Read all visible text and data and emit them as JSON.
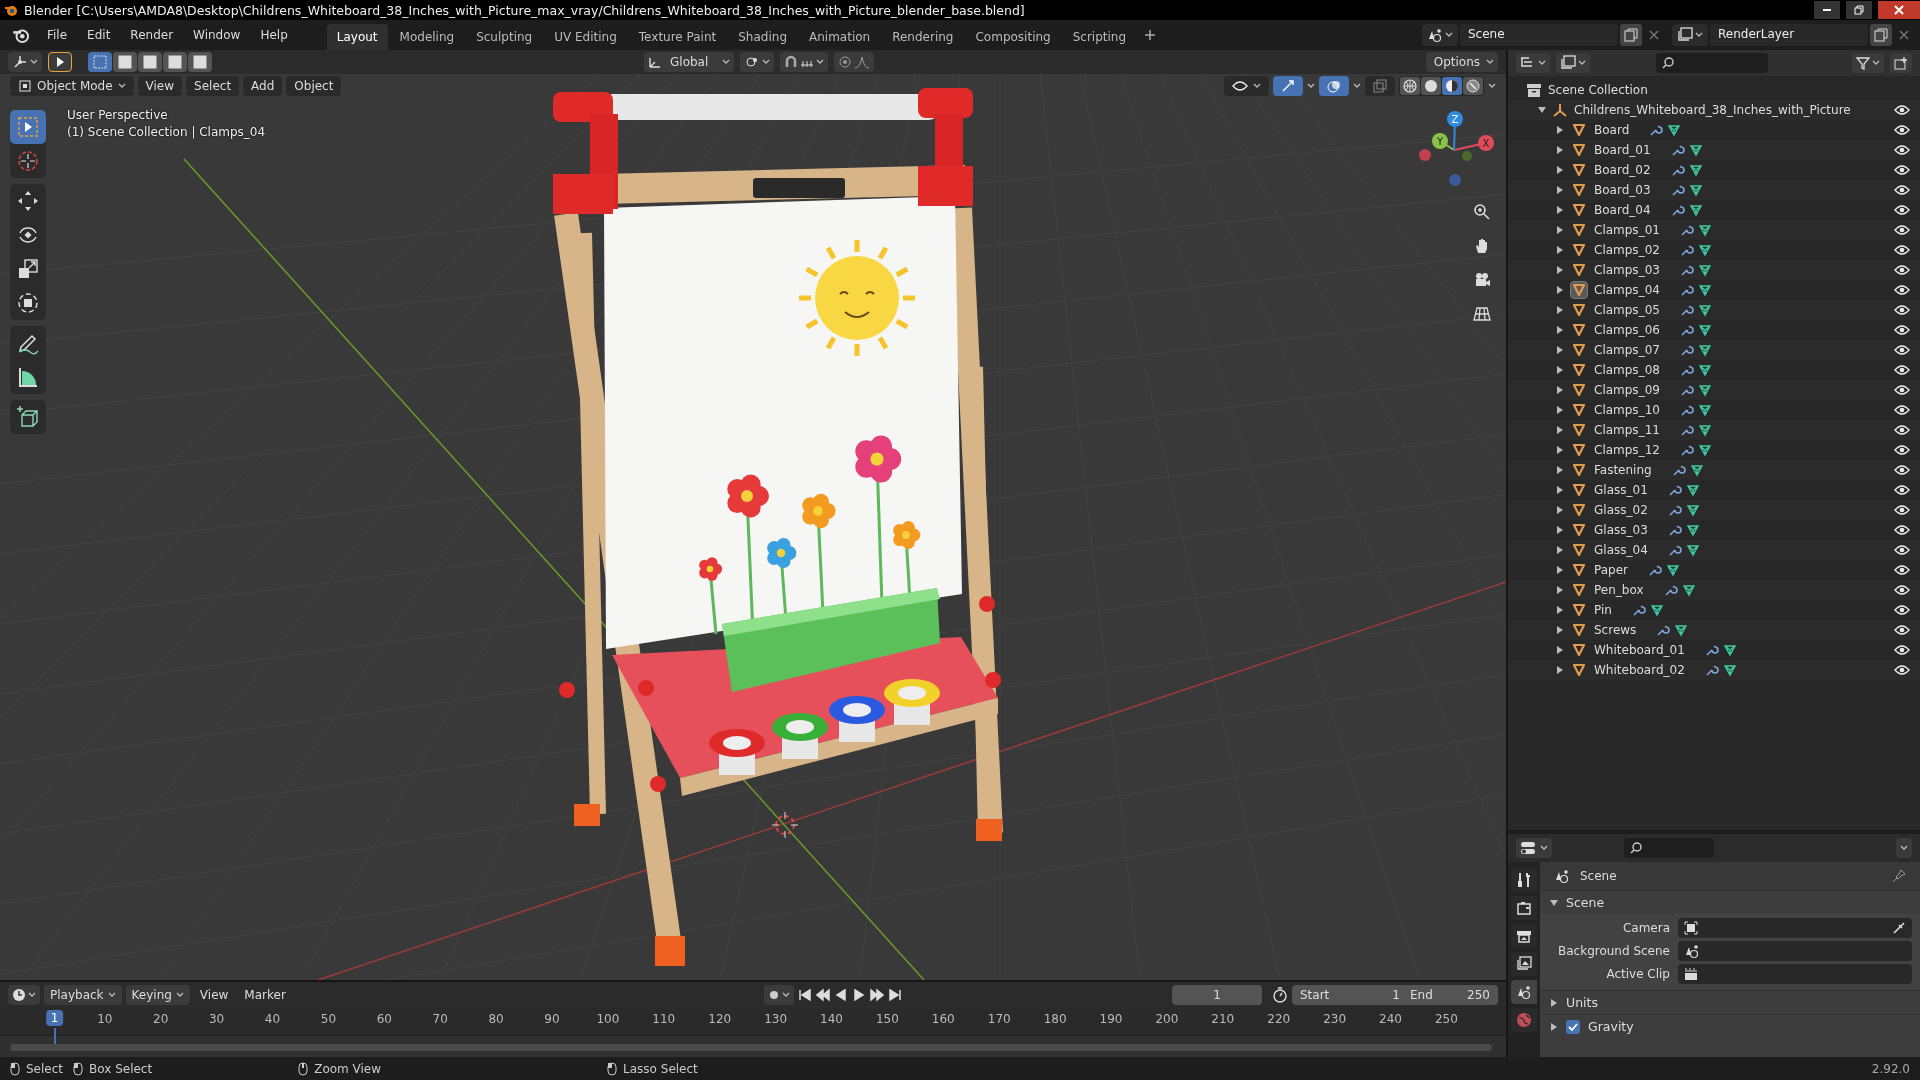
{
  "window": {
    "title": "Blender [C:\\Users\\AMDA8\\Desktop\\Childrens_Whiteboard_38_Inches_with_Picture_max_vray/Childrens_Whiteboard_38_Inches_with_Picture_blender_base.blend]"
  },
  "menu": [
    "File",
    "Edit",
    "Render",
    "Window",
    "Help"
  ],
  "workspaces": [
    {
      "label": "Layout",
      "selected": true
    },
    {
      "label": "Modeling",
      "selected": false
    },
    {
      "label": "Sculpting",
      "selected": false
    },
    {
      "label": "UV Editing",
      "selected": false
    },
    {
      "label": "Texture Paint",
      "selected": false
    },
    {
      "label": "Shading",
      "selected": false
    },
    {
      "label": "Animation",
      "selected": false
    },
    {
      "label": "Rendering",
      "selected": false
    },
    {
      "label": "Compositing",
      "selected": false
    },
    {
      "label": "Scripting",
      "selected": false
    }
  ],
  "top_fields": {
    "scene": "Scene",
    "view_layer": "RenderLayer"
  },
  "tool_settings": {
    "transform_orientation": "Global",
    "snap": false,
    "proportional_editing": false,
    "options": "Options"
  },
  "viewport_header": {
    "mode": "Object Mode",
    "menus": [
      "View",
      "Select",
      "Add",
      "Object"
    ],
    "gizmos": true,
    "overlays": true,
    "xray": false
  },
  "shading_modes": [
    {
      "kind": "wireframe",
      "selected": false
    },
    {
      "kind": "solid",
      "selected": false
    },
    {
      "kind": "material",
      "selected": true
    },
    {
      "kind": "rendered",
      "selected": false
    }
  ],
  "viewport": {
    "view_name": "User Perspective",
    "object_info": "(1) Scene Collection | Clamps_04",
    "gizmo_axes": [
      "X",
      "Y",
      "Z"
    ]
  },
  "tools": [
    {
      "kind": "select",
      "selected": true
    },
    {
      "kind": "cursor",
      "selected": false
    },
    {
      "kind": "move",
      "selected": false
    },
    {
      "kind": "rotate",
      "selected": false
    },
    {
      "kind": "scale",
      "selected": false
    },
    {
      "kind": "transform",
      "selected": false
    },
    {
      "kind": "annotate",
      "selected": false
    },
    {
      "kind": "measure",
      "selected": false
    },
    {
      "kind": "add-cube",
      "selected": false
    }
  ],
  "outliner": {
    "root": "Scene Collection",
    "collection": {
      "name": "Childrens_Whiteboard_38_Inches_with_Picture",
      "expanded": true,
      "children": [
        {
          "name": "Board",
          "expanded": false,
          "selected": false
        },
        {
          "name": "Board_01",
          "expanded": false,
          "selected": false
        },
        {
          "name": "Board_02",
          "expanded": false,
          "selected": false
        },
        {
          "name": "Board_03",
          "expanded": false,
          "selected": false
        },
        {
          "name": "Board_04",
          "expanded": false,
          "selected": false
        },
        {
          "name": "Clamps_01",
          "expanded": false,
          "selected": false
        },
        {
          "name": "Clamps_02",
          "expanded": false,
          "selected": false
        },
        {
          "name": "Clamps_03",
          "expanded": false,
          "selected": false
        },
        {
          "name": "Clamps_04",
          "expanded": false,
          "selected": true
        },
        {
          "name": "Clamps_05",
          "expanded": false,
          "selected": false
        },
        {
          "name": "Clamps_06",
          "expanded": false,
          "selected": false
        },
        {
          "name": "Clamps_07",
          "expanded": false,
          "selected": false
        },
        {
          "name": "Clamps_08",
          "expanded": false,
          "selected": false
        },
        {
          "name": "Clamps_09",
          "expanded": false,
          "selected": false
        },
        {
          "name": "Clamps_10",
          "expanded": false,
          "selected": false
        },
        {
          "name": "Clamps_11",
          "expanded": false,
          "selected": false
        },
        {
          "name": "Clamps_12",
          "expanded": false,
          "selected": false
        },
        {
          "name": "Fastening",
          "expanded": false,
          "selected": false
        },
        {
          "name": "Glass_01",
          "expanded": false,
          "selected": false
        },
        {
          "name": "Glass_02",
          "expanded": false,
          "selected": false
        },
        {
          "name": "Glass_03",
          "expanded": false,
          "selected": false
        },
        {
          "name": "Glass_04",
          "expanded": false,
          "selected": false
        },
        {
          "name": "Paper",
          "expanded": false,
          "selected": false
        },
        {
          "name": "Pen_box",
          "expanded": false,
          "selected": false
        },
        {
          "name": "Pin",
          "expanded": false,
          "selected": false
        },
        {
          "name": "Screws",
          "expanded": false,
          "selected": false
        },
        {
          "name": "Whiteboard_01",
          "expanded": false,
          "selected": false
        },
        {
          "name": "Whiteboard_02",
          "expanded": false,
          "selected": false
        }
      ]
    }
  },
  "properties": {
    "context": "Scene",
    "tabs": [
      {
        "kind": "tool",
        "selected": false
      },
      {
        "kind": "render",
        "selected": false
      },
      {
        "kind": "output",
        "selected": false
      },
      {
        "kind": "view-layer",
        "selected": false
      },
      {
        "kind": "scene",
        "selected": true
      },
      {
        "kind": "world",
        "selected": false
      }
    ],
    "panels": [
      {
        "kind": "panel",
        "title": "Scene",
        "expanded": true,
        "fields": [
          {
            "label": "Camera",
            "kind": "camera"
          },
          {
            "label": "Background Scene",
            "kind": "scene"
          },
          {
            "label": "Active Clip",
            "kind": "clip"
          }
        ]
      },
      {
        "kind": "panel",
        "title": "Units",
        "expanded": false
      },
      {
        "kind": "checkbox-panel",
        "title": "Gravity",
        "expanded": false,
        "checked": true
      }
    ]
  },
  "timeline": {
    "menus": [
      "Playback",
      "Keying",
      "View",
      "Marker"
    ],
    "current_frame": "1",
    "start_label": "Start",
    "start": "1",
    "end_label": "End",
    "end": "250",
    "frame_marker": "1",
    "ticks": [
      "10",
      "20",
      "30",
      "40",
      "50",
      "60",
      "70",
      "80",
      "90",
      "100",
      "110",
      "120",
      "130",
      "140",
      "150",
      "160",
      "170",
      "180",
      "190",
      "200",
      "210",
      "220",
      "230",
      "240",
      "250"
    ]
  },
  "status_bar": {
    "hints": [
      "Select",
      "Box Select",
      "Zoom View",
      "Lasso Select"
    ],
    "version": "2.92.0"
  }
}
